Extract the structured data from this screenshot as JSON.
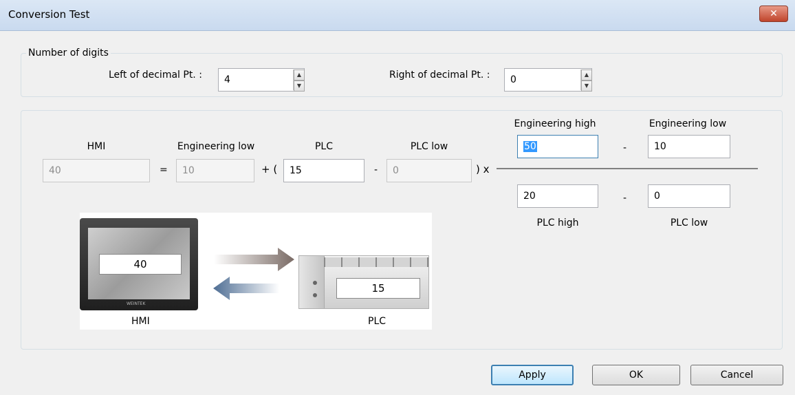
{
  "window": {
    "title": "Conversion Test",
    "close_glyph": "✕"
  },
  "digits": {
    "legend": "Number of digits",
    "left_label": "Left of decimal Pt. :",
    "left_value": "4",
    "right_label": "Right of decimal Pt. :",
    "right_value": "0"
  },
  "formula": {
    "hmi_header": "HMI",
    "eng_low_header": "Engineering low",
    "plc_header": "PLC",
    "plc_low_header": "PLC low",
    "hmi_value": "40",
    "equals": "=",
    "eng_low_value": "10",
    "plus_paren": "+ (",
    "plc_value": "15",
    "minus1": "-",
    "plc_low_value": "0",
    "close_times": ") x",
    "num_eng_high_label": "Engineering high",
    "num_eng_low_label": "Engineering low",
    "num_eng_high_value": "50",
    "num_minus": "-",
    "num_eng_low_value": "10",
    "den_plc_high_value": "20",
    "den_minus": "-",
    "den_plc_low_value": "0",
    "den_plc_high_label": "PLC high",
    "den_plc_low_label": "PLC low"
  },
  "illustration": {
    "hmi_value": "40",
    "plc_value": "15",
    "hmi_caption": "HMI",
    "plc_caption": "PLC",
    "brand": "WEINTEK"
  },
  "buttons": {
    "apply": "Apply",
    "ok": "OK",
    "cancel": "Cancel"
  }
}
